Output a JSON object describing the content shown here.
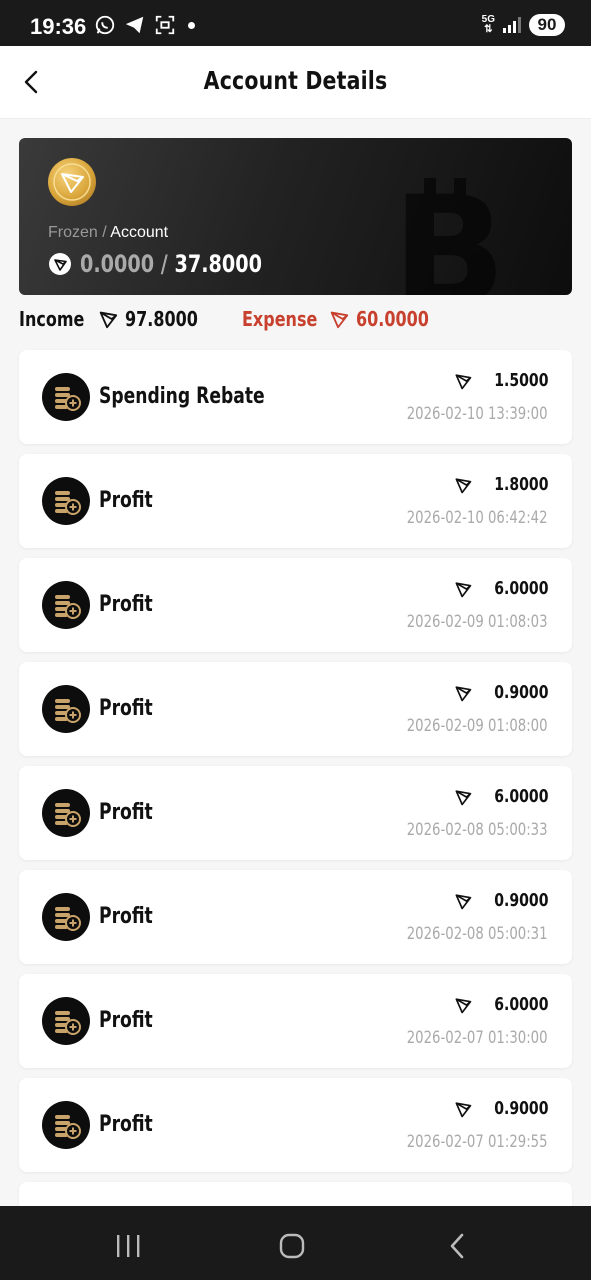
{
  "status_bar": {
    "time": "19:36",
    "network": "5G",
    "battery": "90"
  },
  "header": {
    "title": "Account Details"
  },
  "card": {
    "frozen_label": "Frozen",
    "separator": "/",
    "account_label": "Account",
    "frozen_value": "0.0000",
    "account_value": "37.8000",
    "amount_separator": " / "
  },
  "summary": {
    "income_label": "Income",
    "income_value": "97.8000",
    "expense_label": "Expense",
    "expense_value": "60.0000"
  },
  "transactions": [
    {
      "name": "Spending Rebate",
      "amount": "1.5000",
      "time": "2026-02-10 13:39:00"
    },
    {
      "name": "Profit",
      "amount": "1.8000",
      "time": "2026-02-10 06:42:42"
    },
    {
      "name": "Profit",
      "amount": "6.0000",
      "time": "2026-02-09 01:08:03"
    },
    {
      "name": "Profit",
      "amount": "0.9000",
      "time": "2026-02-09 01:08:00"
    },
    {
      "name": "Profit",
      "amount": "6.0000",
      "time": "2026-02-08 05:00:33"
    },
    {
      "name": "Profit",
      "amount": "0.9000",
      "time": "2026-02-08 05:00:31"
    },
    {
      "name": "Profit",
      "amount": "6.0000",
      "time": "2026-02-07 01:30:00"
    },
    {
      "name": "Profit",
      "amount": "0.9000",
      "time": "2026-02-07 01:29:55"
    }
  ],
  "colors": {
    "expense": "#c8402e",
    "coin_gold": "#d9a53a",
    "icon_gold": "#c9a46a"
  }
}
